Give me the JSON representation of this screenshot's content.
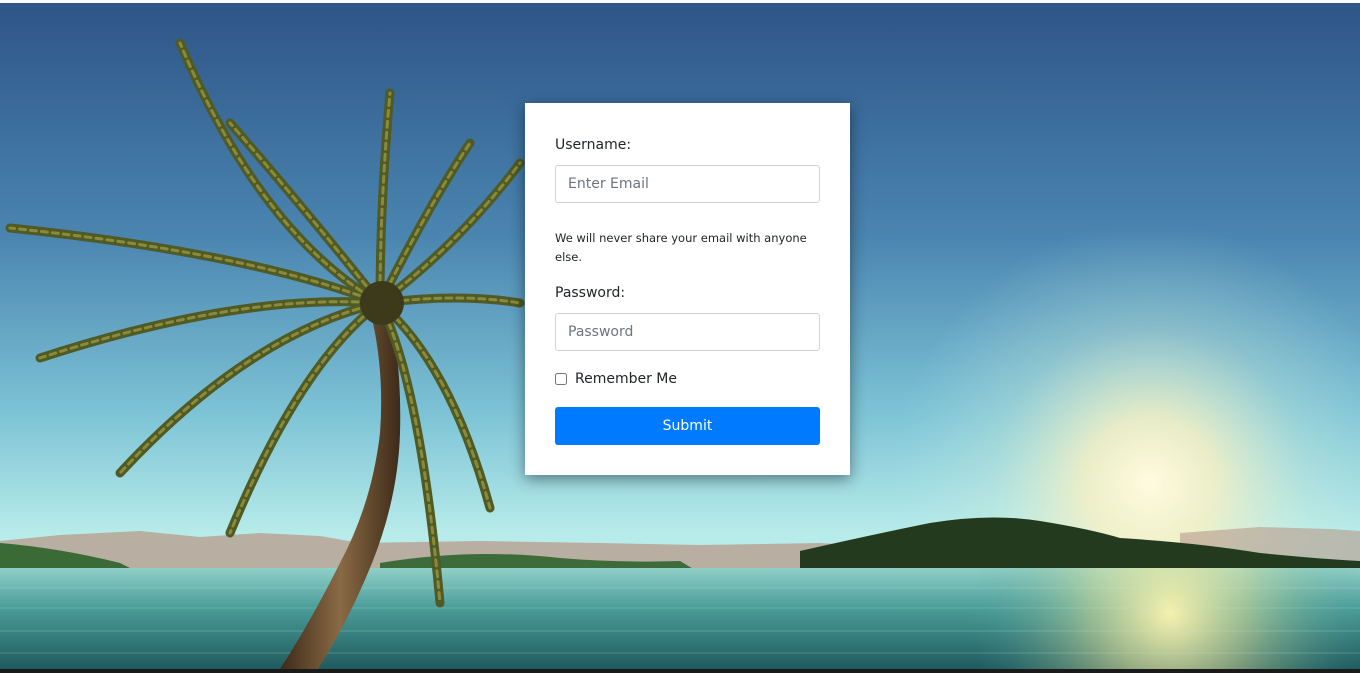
{
  "form": {
    "username_label": "Username:",
    "username_placeholder": "Enter Email",
    "username_value": "",
    "help_text": "We will never share your email with anyone else.",
    "password_label": "Password:",
    "password_placeholder": "Password",
    "password_value": "",
    "remember_label": "Remember Me",
    "remember_checked": false,
    "submit_label": "Submit"
  },
  "colors": {
    "primary": "#007bff",
    "card_background": "#ffffff",
    "input_border": "#ced4da",
    "sky_top": "#2e5c8c",
    "sky_horizon": "#9ee0e6",
    "sun": "#fff6c8",
    "water": "#3f8f8c"
  },
  "background": {
    "scene": "tropical beach sunset with palm tree"
  }
}
